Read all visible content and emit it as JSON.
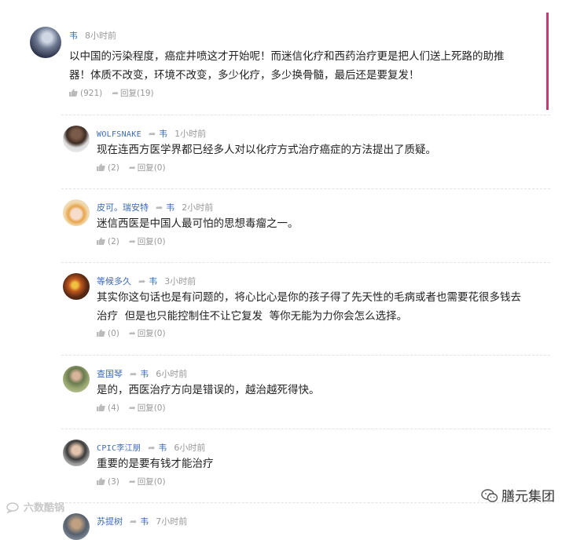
{
  "main": {
    "user": "韦",
    "time": "8小时前",
    "text_line1": "以中国的污染程度，癌症井喷这才开始呢！而迷信化疗和西药治疗更是把人们送上死路的助推",
    "text_line2": "器！体质不改变，环境不改变，多少化疗，多少换骨髓，最后还是要复发！",
    "likes": "(921)",
    "reply_label": "回复",
    "reply_count": "(19)",
    "accent_color": "#c8376e"
  },
  "replies": [
    {
      "user": "WOLFSNAKE",
      "reply_to": "韦",
      "time": "1小时前",
      "text_line1": "现在连西方医学界都已经多人对以化疗方式治疗癌症的方法提出了质疑。",
      "text_line2": "",
      "likes": "(2)",
      "reply_label": "回复",
      "reply_count": "(0)"
    },
    {
      "user": "皮可。瑞安特",
      "reply_to": "韦",
      "time": "2小时前",
      "text_line1": "迷信西医是中国人最可怕的思想毒瘤之一。",
      "text_line2": "",
      "likes": "(2)",
      "reply_label": "回复",
      "reply_count": "(0)"
    },
    {
      "user": "等候多久",
      "reply_to": "韦",
      "time": "3小时前",
      "text_line1": "其实你这句话也是有问题的，将心比心是你的孩子得了先天性的毛病或者也需要花很多钱去",
      "text_line2": "治疗  但是也只能控制住不让它复发  等你无能为力你会怎么选择。",
      "likes": "(0)",
      "reply_label": "回复",
      "reply_count": "(0)"
    },
    {
      "user": "查国琴",
      "reply_to": "韦",
      "time": "6小时前",
      "text_line1": "是的，西医治疗方向是错误的，越治越死得快。",
      "text_line2": "",
      "likes": "(4)",
      "reply_label": "回复",
      "reply_count": "(0)"
    },
    {
      "user": "CPIC李江朋",
      "reply_to": "韦",
      "time": "6小时前",
      "text_line1": "重要的是要有钱才能治疗",
      "text_line2": "",
      "likes": "(3)",
      "reply_label": "回复",
      "reply_count": "(0)"
    },
    {
      "user": "苏提树",
      "reply_to": "韦",
      "time": "7小时前"
    }
  ],
  "watermark_left": "六数酷锅",
  "watermark_right": "膳元集团"
}
